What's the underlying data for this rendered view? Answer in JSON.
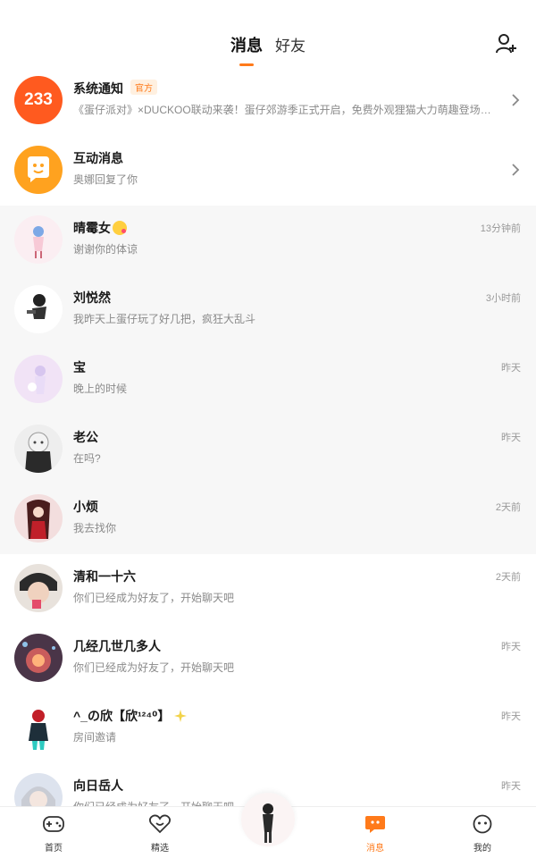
{
  "header": {
    "tabs": [
      "消息",
      "好友"
    ],
    "active_tab": 0,
    "add_friend_icon": "add-person-icon"
  },
  "pinned": [
    {
      "name": "系统通知",
      "badge": "官方",
      "preview": "《蛋仔派对》×DUCKOO联动来袭！蛋仔郊游季正式开启，免费外观狸猫大力萌趣登场！...",
      "avatar_text": "233"
    },
    {
      "name": "互动消息",
      "preview": "奥娜回复了你"
    }
  ],
  "conversations": [
    {
      "name": "晴霉女",
      "preview": "谢谢你的体谅",
      "time": "13分钟前",
      "unread_highlight": true,
      "avatar_bg": "#fbeef2"
    },
    {
      "name": "刘悦然",
      "preview": "我昨天上蛋仔玩了好几把，疯狂大乱斗",
      "time": "3小时前",
      "unread_highlight": true,
      "avatar_bg": "#ffffff"
    },
    {
      "name": "宝",
      "preview": "晚上的时候",
      "time": "昨天",
      "unread_highlight": true,
      "avatar_bg": "#f1e3f6"
    },
    {
      "name": "老公",
      "preview": "在吗?",
      "time": "昨天",
      "unread_highlight": true,
      "avatar_bg": "#eeeeee"
    },
    {
      "name": "小烦",
      "preview": "我去找你",
      "time": "2天前",
      "unread_highlight": true,
      "avatar_bg": "#f3dede"
    },
    {
      "name": "清和一十六",
      "preview": "你们已经成为好友了，开始聊天吧",
      "time": "2天前",
      "unread_highlight": false,
      "avatar_bg": "#e8e2dc"
    },
    {
      "name": "几经几世几多人",
      "preview": "你们已经成为好友了，开始聊天吧",
      "time": "昨天",
      "unread_highlight": false,
      "avatar_bg": "#4a3548"
    },
    {
      "name": "^_の欣【欣¹²⁴⁰】",
      "preview": "房间邀请",
      "time": "昨天",
      "unread_highlight": false,
      "avatar_bg": "#ffffff"
    },
    {
      "name": "向日岳人",
      "preview": "你们已经成为好友了，开始聊天吧",
      "time": "昨天",
      "unread_highlight": false,
      "avatar_bg": "#dde3ee"
    }
  ],
  "bottom_nav": [
    {
      "label": "首页",
      "icon": "gamepad-icon"
    },
    {
      "label": "精选",
      "icon": "heart-icon"
    },
    {
      "label": "消息",
      "icon": "chat-bubble-icon",
      "active": true
    },
    {
      "label": "我的",
      "icon": "smiley-face-icon"
    }
  ],
  "colors": {
    "accent": "#ff7a1a",
    "unread_bg": "#f7f7f7"
  }
}
